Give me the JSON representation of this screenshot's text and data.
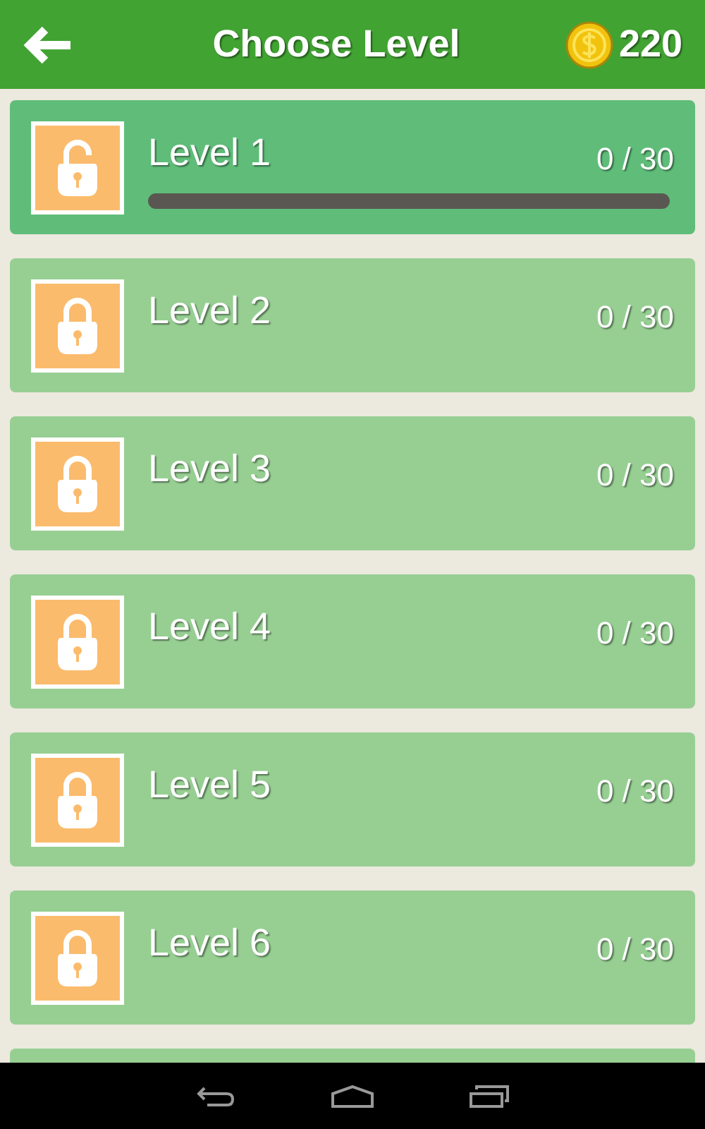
{
  "header": {
    "title": "Choose Level",
    "coins": "220"
  },
  "levels": [
    {
      "name": "Level 1",
      "score": "0 / 30",
      "unlocked": true,
      "level": 0
    },
    {
      "name": "Level 2",
      "score": "0 / 30",
      "unlocked": false
    },
    {
      "name": "Level 3",
      "score": "0 / 30",
      "unlocked": false
    },
    {
      "name": "Level 4",
      "score": "0 / 30",
      "unlocked": false
    },
    {
      "name": "Level 5",
      "score": "0 / 30",
      "unlocked": false
    },
    {
      "name": "Level 6",
      "score": "0 / 30",
      "unlocked": false
    }
  ]
}
